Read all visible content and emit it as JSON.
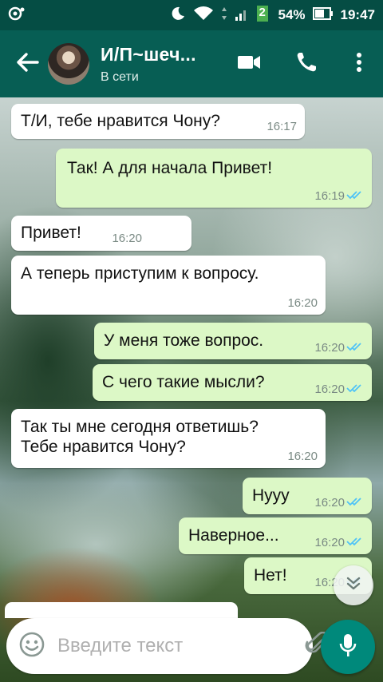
{
  "status_bar": {
    "battery": "54%",
    "time": "19:47",
    "sim_badge": "2"
  },
  "header": {
    "contact_name": "И/П~шеч...",
    "contact_status": "В сети",
    "icons": [
      "back-arrow-icon",
      "video-call-icon",
      "phone-call-icon",
      "more-vert-icon"
    ]
  },
  "messages": [
    {
      "dir": "in",
      "text": "Т/И, тебе нравится Чону?",
      "time": "16:17"
    },
    {
      "dir": "out",
      "text": "Так! А для начала Привет!",
      "time": "16:19",
      "ticks": "read"
    },
    {
      "dir": "in",
      "text": "Привет!",
      "time": "16:20"
    },
    {
      "dir": "in",
      "text": "А теперь приступим к вопросу.",
      "time": "16:20"
    },
    {
      "dir": "out",
      "text": "У меня тоже вопрос.",
      "time": "16:20",
      "ticks": "read"
    },
    {
      "dir": "out",
      "text": "С чего такие мысли?",
      "time": "16:20",
      "ticks": "read"
    },
    {
      "dir": "in",
      "text": "Так ты мне сегодня ответишь? Тебе нравится Чону?",
      "time": "16:20"
    },
    {
      "dir": "out",
      "text": "Нууу",
      "time": "16:20",
      "ticks": "read"
    },
    {
      "dir": "out",
      "text": "Наверное...",
      "time": "16:20",
      "ticks": "read"
    },
    {
      "dir": "out",
      "text": "Нет!",
      "time": "16:20",
      "ticks": "read"
    }
  ],
  "composer": {
    "placeholder": "Введите текст"
  },
  "colors": {
    "header": "#075e54",
    "status": "#054d44",
    "out_bubble": "#dcf8c6",
    "in_bubble": "#ffffff",
    "read_tick": "#4fc3f7",
    "mic_button": "#00897b"
  }
}
